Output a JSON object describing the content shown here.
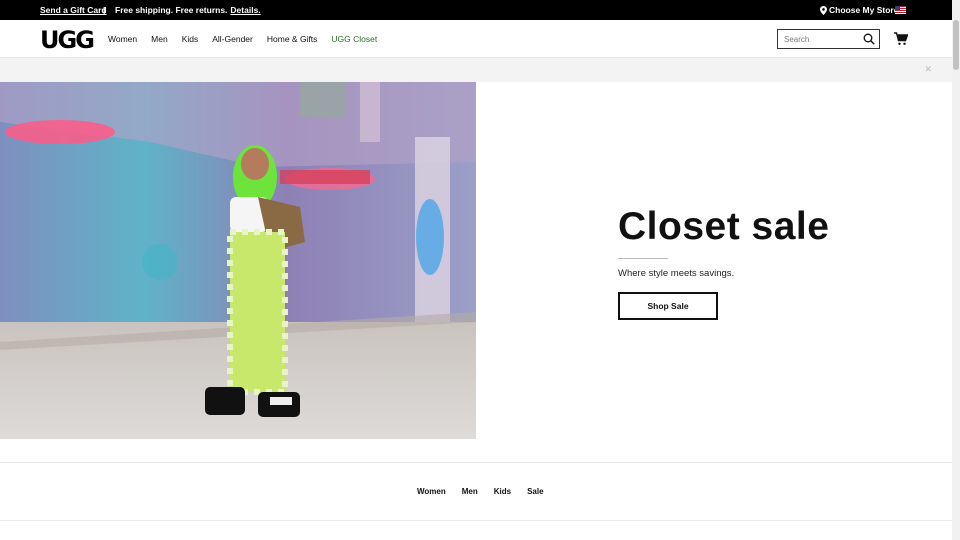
{
  "topbar": {
    "gift_card": "Send a Gift Card",
    "separator": "|",
    "shipping": "Free shipping. Free returns.",
    "details": "Details.",
    "store": "Choose My Store",
    "store_icon": "map-pin-icon",
    "flag_icon": "us-flag-icon"
  },
  "header": {
    "logo": "UGG",
    "nav": [
      "Women",
      "Men",
      "Kids",
      "All-Gender",
      "Home & Gifts",
      "UGG Closet"
    ],
    "search_placeholder": "Search",
    "search_icon": "search-icon",
    "cart_icon": "cart-icon"
  },
  "promo": {
    "close_icon": "close-icon",
    "close_glyph": "✕"
  },
  "hero": {
    "title": "Closet sale",
    "subtitle": "Where style meets savings.",
    "button": "Shop Sale"
  },
  "footer_nav": [
    "Women",
    "Men",
    "Kids",
    "Sale"
  ],
  "colors": {
    "topbar_bg": "#000000",
    "closet_link": "#2a6d2a",
    "promo_bg": "#f3f3f3"
  }
}
